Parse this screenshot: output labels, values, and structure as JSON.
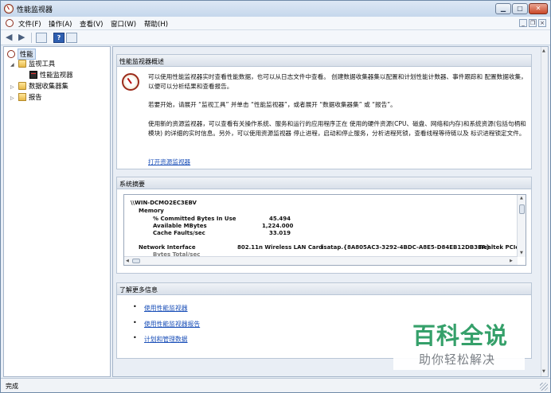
{
  "window": {
    "title": "性能监视器"
  },
  "menu": {
    "items": [
      "文件(F)",
      "操作(A)",
      "查看(V)",
      "窗口(W)",
      "帮助(H)"
    ]
  },
  "toolbar": {
    "help_label": "?"
  },
  "tree": {
    "root": "性能",
    "monitor_tools": "监视工具",
    "perf_monitor": "性能监视器",
    "data_collector_sets": "数据收集器集",
    "reports": "报告"
  },
  "overview": {
    "header": "性能监视器概述",
    "p1": "可以使用性能监视器实时查看性能数据，也可以从日志文件中查看。 创建数据收集器集以配置和计划性能计数器、事件跟踪和 配置数据收集，以便可以分析结果和查看报告。",
    "p2": "若要开始，请展开 “监视工具” 并单击 “性能监视器”，或者展开 “数据收集器集” 或 “报告”。",
    "p3": "使用新的资源监视器，可以查看有关操作系统、服务和运行的应用程序正在 使用的硬件资源(CPU、磁盘、网络和内存)和系统资源(包括句柄和模块) 的详细的实时信息。另外，可以使用资源监视器 停止进程，启动和停止服务，分析进程死锁，查看线程等待链以及 标识进程锁定文件。",
    "link": "打开资源监视器"
  },
  "summary": {
    "header": "系统摘要",
    "host": "\\\\WIN-DCMO2EC3EBV",
    "memory": "Memory",
    "counters": [
      {
        "name": "% Committed Bytes In Use",
        "value": "45.494"
      },
      {
        "name": "Available MBytes",
        "value": "1,224.000"
      },
      {
        "name": "Cache Faults/sec",
        "value": "33.019"
      }
    ],
    "network_label": "Network Interface",
    "net_cols": [
      "802.11n Wireless LAN Card",
      "isatap.{8A805AC3-3292-4BDC-A8E5-D84EB12DB3EA}",
      "Realtek PCIe"
    ],
    "partial_row": "Bytes Total/sec"
  },
  "learn_more": {
    "header": "了解更多信息",
    "links": [
      "使用性能监视器",
      "使用性能监视器报告",
      "计划和管理数据"
    ]
  },
  "watermark": {
    "main": "百科全说",
    "sub": "助你轻松解决"
  },
  "status": {
    "text": "完成"
  }
}
